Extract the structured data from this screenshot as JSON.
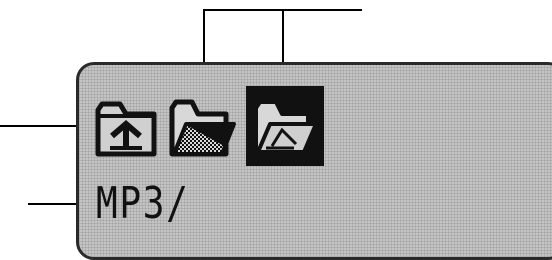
{
  "display": {
    "path_text": "MP3/"
  },
  "icons": {
    "parent_folder": "folder-up-arrow-icon",
    "folder": "folder-icon",
    "folder_selected": "folder-selected-icon"
  },
  "colors": {
    "lcd_background": "#c4c4c4",
    "lcd_pixel": "#111111",
    "callout_line": "#000000"
  }
}
